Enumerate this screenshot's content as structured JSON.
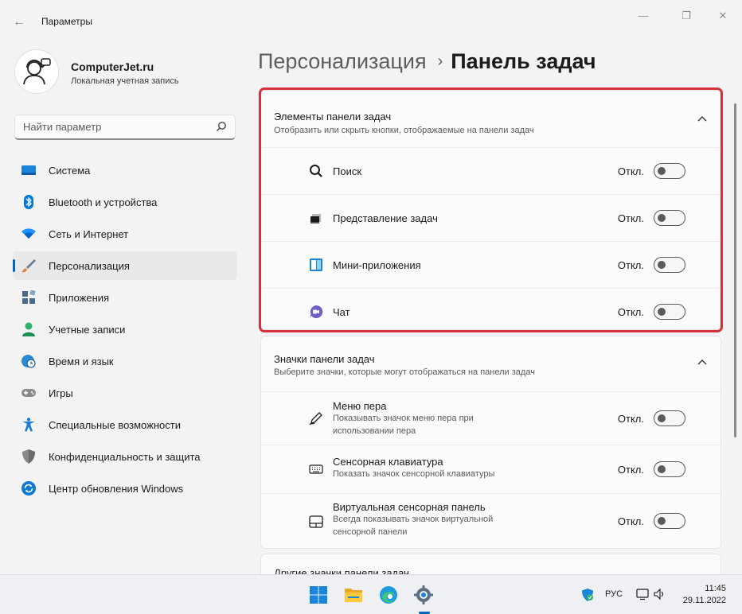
{
  "app": {
    "title": "Параметры"
  },
  "user": {
    "name": "ComputerJet.ru",
    "account_type": "Локальная учетная запись"
  },
  "search": {
    "placeholder": "Найти параметр"
  },
  "sidebar": {
    "items": [
      {
        "label": "Система",
        "icon": "system-icon",
        "color": "#0078d4"
      },
      {
        "label": "Bluetooth и устройства",
        "icon": "bluetooth-icon",
        "color": "#0078d4"
      },
      {
        "label": "Сеть и Интернет",
        "icon": "wifi-icon",
        "color": "#1e90ff"
      },
      {
        "label": "Персонализация",
        "icon": "brush-icon",
        "color": "#e0823a"
      },
      {
        "label": "Приложения",
        "icon": "apps-icon",
        "color": "#4a6b8a"
      },
      {
        "label": "Учетные записи",
        "icon": "person-icon",
        "color": "#2fb36c"
      },
      {
        "label": "Время и язык",
        "icon": "globe-clock-icon",
        "color": "#2a8bd6"
      },
      {
        "label": "Игры",
        "icon": "gamepad-icon",
        "color": "#7a7a7a"
      },
      {
        "label": "Специальные возможности",
        "icon": "accessibility-icon",
        "color": "#1a7fd4"
      },
      {
        "label": "Конфиденциальность и защита",
        "icon": "shield-icon",
        "color": "#7a7a7a"
      },
      {
        "label": "Центр обновления Windows",
        "icon": "update-icon",
        "color": "#0078d4"
      }
    ],
    "active_index": 3
  },
  "breadcrumb": {
    "parent": "Персонализация",
    "separator": "›",
    "current": "Панель задач"
  },
  "taskbar_items": {
    "title": "Элементы панели задач",
    "subtitle": "Отобразить или скрыть кнопки, отображаемые на панели задач",
    "rows": [
      {
        "label": "Поиск",
        "icon": "search-icon",
        "state": "Откл."
      },
      {
        "label": "Представление задач",
        "icon": "task-view-icon",
        "state": "Откл."
      },
      {
        "label": "Мини-приложения",
        "icon": "widgets-icon",
        "state": "Откл."
      },
      {
        "label": "Чат",
        "icon": "chat-icon",
        "state": "Откл."
      }
    ]
  },
  "taskbar_icons": {
    "title": "Значки панели задач",
    "subtitle": "Выберите значки, которые могут отображаться на панели задач",
    "rows": [
      {
        "label": "Меню пера",
        "desc": "Показывать значок меню пера при использовании пера",
        "icon": "pen-icon",
        "state": "Откл."
      },
      {
        "label": "Сенсорная клавиатура",
        "desc": "Показать значок сенсорной клавиатуры",
        "icon": "keyboard-icon",
        "state": "Откл."
      },
      {
        "label": "Виртуальная сенсорная панель",
        "desc": "Всегда показывать значок виртуальной сенсорной панели",
        "icon": "touchpad-icon",
        "state": "Откл."
      }
    ]
  },
  "other_icons": {
    "title": "Другие значки панели задач"
  },
  "tray": {
    "language": "РУС",
    "time": "11:45",
    "date": "29.11.2022"
  },
  "colors": {
    "accent": "#0067c0",
    "highlight": "#d6303a"
  }
}
